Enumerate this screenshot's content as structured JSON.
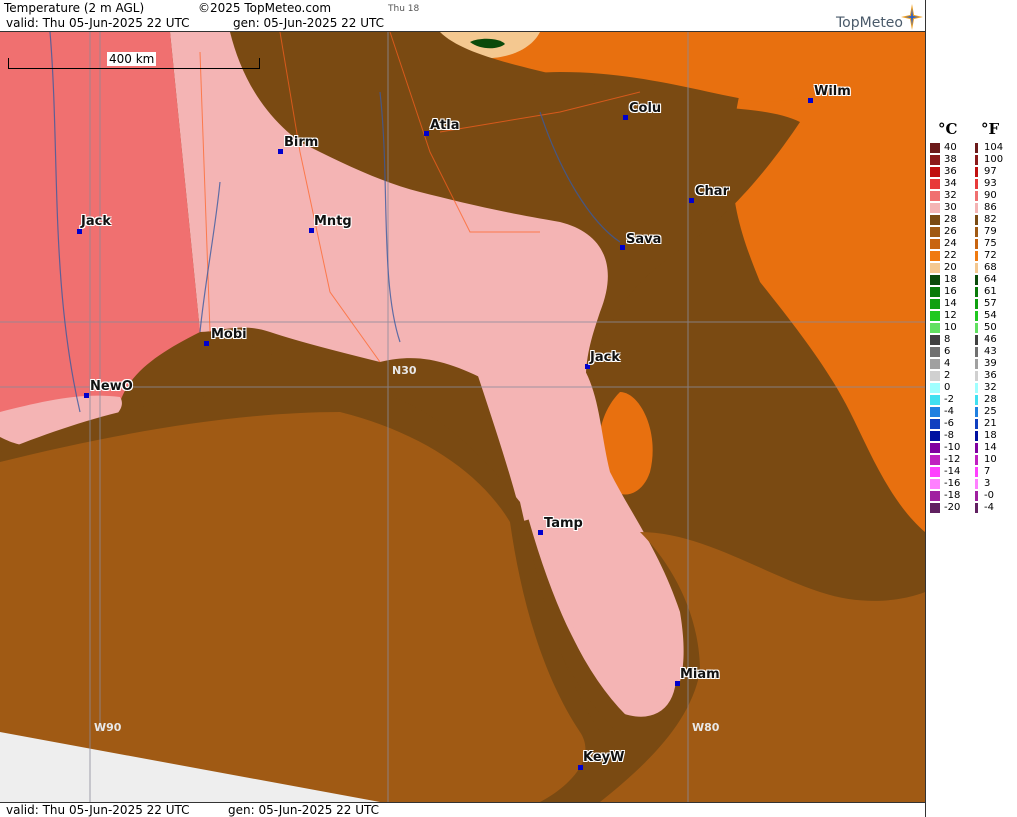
{
  "header": {
    "product": "Temperature (2 m AGL)",
    "copyright": "©2025 TopMeteo.com",
    "valid": "valid:  Thu  05-Jun-2025  22 UTC",
    "gen": "gen:  05-Jun-2025 22 UTC",
    "day_tag": "Thu 18",
    "brand": "TopMeteo"
  },
  "footer": {
    "valid": "valid:  Thu  05-Jun-2025  22 UTC",
    "gen": "gen:  05-Jun-2025 22 UTC"
  },
  "scale_bar": "400 km",
  "grid_labels": {
    "n30": "N30",
    "w90": "W90",
    "w80": "W80"
  },
  "cities": [
    {
      "name": "Birm"
    },
    {
      "name": "Atla"
    },
    {
      "name": "Colu"
    },
    {
      "name": "Wilm"
    },
    {
      "name": "Jack"
    },
    {
      "name": "Mntg"
    },
    {
      "name": "Char"
    },
    {
      "name": "Sava"
    },
    {
      "name": "Mobi"
    },
    {
      "name": "Jack"
    },
    {
      "name": "NewO"
    },
    {
      "name": "Tamp"
    },
    {
      "name": "Miam"
    },
    {
      "name": "KeyW"
    }
  ],
  "legend": {
    "unit_c": "°C",
    "unit_f": "°F",
    "celsius": [
      "40",
      "38",
      "36",
      "34",
      "32",
      "30",
      "28",
      "26",
      "24",
      "22",
      "20",
      "18",
      "16",
      "14",
      "12",
      "10",
      "8",
      "6",
      "4",
      "2",
      "0",
      "-2",
      "-4",
      "-6",
      "-8",
      "-10",
      "-12",
      "-14",
      "-16",
      "-18",
      "-20"
    ],
    "fahrenheit": [
      "104",
      "100",
      "97",
      "93",
      "90",
      "86",
      "82",
      "79",
      "75",
      "72",
      "68",
      "64",
      "61",
      "57",
      "54",
      "50",
      "46",
      "43",
      "39",
      "36",
      "32",
      "28",
      "25",
      "21",
      "18",
      "14",
      "10",
      "7",
      "3",
      "-0",
      "-4"
    ],
    "colors": [
      "#6b1a1a",
      "#8b1a1a",
      "#c01010",
      "#e83a3a",
      "#f07070",
      "#f4b4b4",
      "#7a4a12",
      "#a05a14",
      "#c86410",
      "#f07a10",
      "#f4c890",
      "#0a4a0a",
      "#0a7a0a",
      "#10a010",
      "#20c820",
      "#60e060",
      "#404040",
      "#707070",
      "#a0a0a0",
      "#d0d0d0",
      "#a0ffff",
      "#40e0f0",
      "#2080e0",
      "#1040c0",
      "#0010a0",
      "#8000a0",
      "#c020c0",
      "#ff40ff",
      "#ff80ff",
      "#a020a0",
      "#602060"
    ]
  }
}
